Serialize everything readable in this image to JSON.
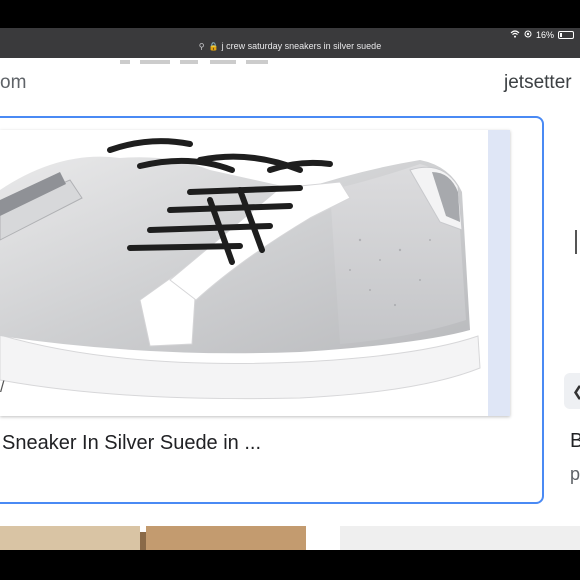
{
  "status_bar": {
    "url": "j crew saturday sneakers in silver suede",
    "battery": "16%"
  },
  "results": {
    "left_source": "om",
    "right_source": "jetsetter",
    "main_card": {
      "caption": "Sneaker In Silver Suede in ...",
      "image_alt": "silver suede sneaker with black laces"
    },
    "right_card": {
      "caption_initial": "B",
      "sub_initial": "p"
    }
  },
  "colors": {
    "accent": "#4a8af4",
    "status_bar": "#3a3a3c"
  }
}
